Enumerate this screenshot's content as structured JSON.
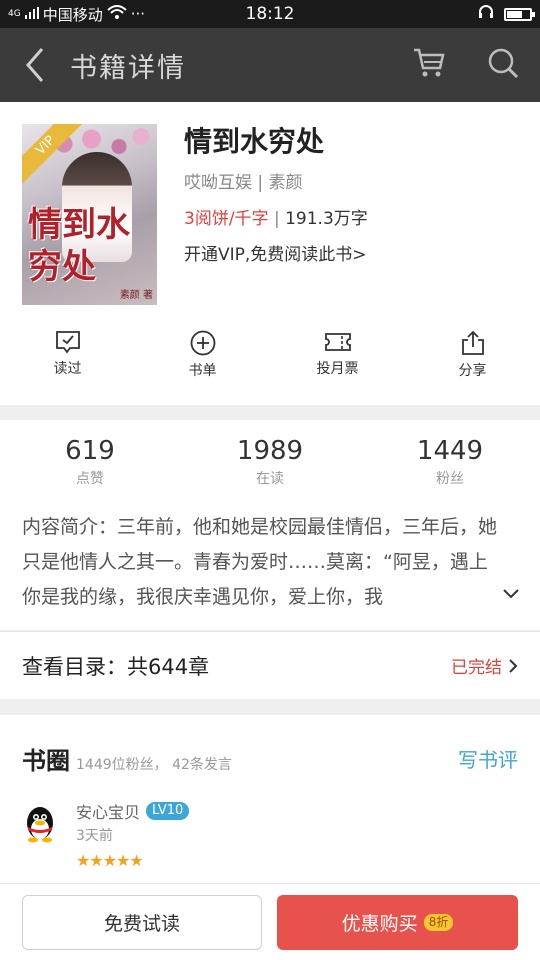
{
  "status_bar": {
    "carrier_prefix": "4G",
    "carrier": "中国移动",
    "more": "···",
    "time": "18:12",
    "battery_level": 0.7
  },
  "nav": {
    "title": "书籍详情",
    "icons": [
      "back-icon",
      "cart-icon",
      "search-icon"
    ]
  },
  "book": {
    "cover_title": "情到水穷处",
    "cover_author": "素颜 著",
    "vip_badge": "VIP",
    "title": "情到水穷处",
    "publisher": "哎呦互娱",
    "separator": " | ",
    "author": "素颜",
    "price": "3阅饼/千字",
    "word_count": "191.3万字",
    "vip_offer": "开通VIP,免费阅读此书>"
  },
  "actions": [
    {
      "label": "读过",
      "icon": "checkbox-icon"
    },
    {
      "label": "书单",
      "icon": "plus-circle-icon"
    },
    {
      "label": "投月票",
      "icon": "ticket-icon"
    },
    {
      "label": "分享",
      "icon": "share-icon"
    }
  ],
  "stats": [
    {
      "value": "619",
      "label": "点赞"
    },
    {
      "value": "1989",
      "label": "在读"
    },
    {
      "value": "1449",
      "label": "粉丝"
    }
  ],
  "intro": "内容简介：三年前，他和她是校园最佳情侣，三年后，她只是他情人之其一。青春为爱时……莫离：“阿昱，遇上你是我的缘，我很庆幸遇见你，爱上你，我",
  "catalog": {
    "label": "查看目录：共644章",
    "status": "已完结"
  },
  "circle": {
    "title": "书圈",
    "stats": "1449位粉丝， 42条发言",
    "write_review": "写书评",
    "comment": {
      "user": "安心宝贝",
      "level": "LV10",
      "time": "3天前",
      "stars": "★★★★★",
      "rating": 5
    }
  },
  "bottom": {
    "free_read": "免费试读",
    "buy": "优惠购买",
    "discount": "8折"
  },
  "colors": {
    "accent_red": "#e7524c",
    "link_blue": "#3da6d8",
    "nav_bg": "#3b3b3b",
    "star": "#f3a21f"
  }
}
